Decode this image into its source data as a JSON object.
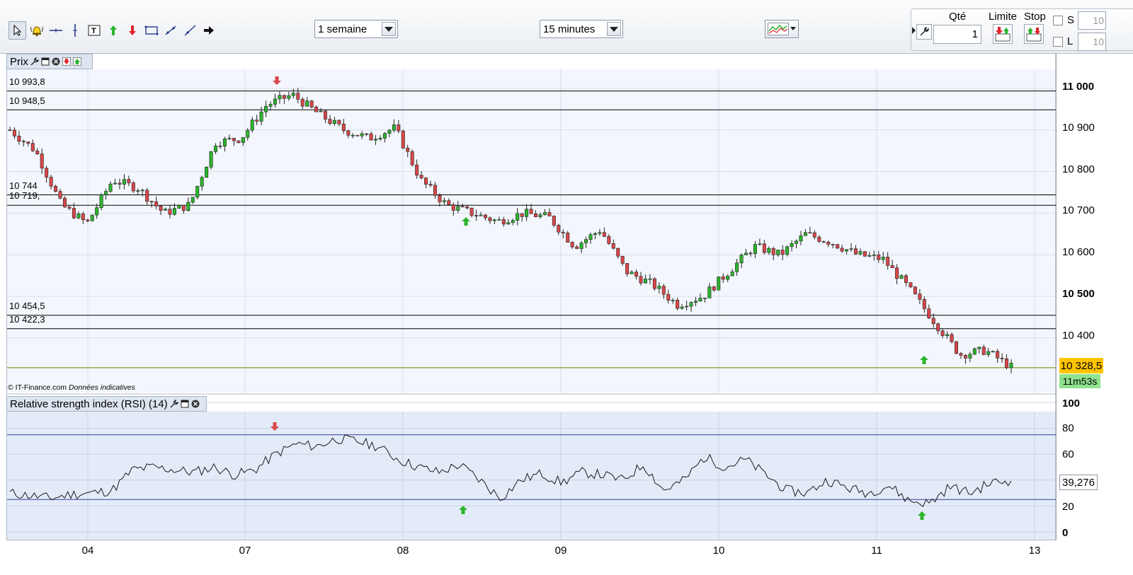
{
  "toolbar": {
    "tools": [
      "cursor-icon",
      "alert-bell-icon",
      "horizontal-line-icon",
      "vertical-line-icon",
      "text-tool-icon",
      "buy-arrow-icon",
      "sell-arrow-icon",
      "rectangle-icon",
      "trendline-icon",
      "ray-icon",
      "arrow-right-icon"
    ],
    "period": "1 semaine",
    "interval": "15 minutes"
  },
  "order_panel": {
    "qty_label": "Qté",
    "qty_value": "1",
    "limit_label": "Limite",
    "stop_label": "Stop",
    "s_label": "S",
    "l_label": "L",
    "s_value": "10",
    "l_value": "10"
  },
  "price_panel": {
    "title": "Prix",
    "levels": [
      "10 993,8",
      "10 948,5",
      "10 744",
      "10 719,",
      "10 454,5",
      "10 422,3"
    ],
    "y_ticks": [
      "11 000",
      "10 900",
      "10 800",
      "10 700",
      "10 600",
      "10 500",
      "10 400"
    ],
    "last_price": "10 328,5",
    "timer": "11m53s",
    "copyright": "© IT-Finance.com",
    "disclaimer": "Données indicatives"
  },
  "rsi_panel": {
    "title": "Relative strength index (RSI) (14)",
    "y_ticks": [
      "100",
      "80",
      "60",
      "40",
      "20",
      "0"
    ],
    "last_value": "39,276"
  },
  "x_axis": {
    "labels": [
      "04",
      "07",
      "08",
      "09",
      "10",
      "11",
      "13"
    ]
  },
  "colors": {
    "up": "#2bb52b",
    "down": "#d9474a",
    "level": "#000000",
    "last_price_line": "#8a9a2a",
    "rsi_line": "#1a1a1a",
    "rsi_band": "#2d3f9b"
  },
  "chart_data": [
    {
      "type": "candlestick",
      "title": "Prix",
      "x": [
        "04",
        "07",
        "08",
        "09",
        "10",
        "11",
        "13"
      ],
      "series": [
        {
          "name": "Prix",
          "values": [
            10900,
            10850,
            10720,
            10675,
            10780,
            10760,
            10700,
            10720,
            10870,
            10880,
            10960,
            10985,
            10940,
            10900,
            10880,
            10905,
            10780,
            10720,
            10700,
            10680,
            10700,
            10690,
            10620,
            10660,
            10560,
            10530,
            10480,
            10500,
            10560,
            10620,
            10600,
            10650,
            10630,
            10600,
            10590,
            10520,
            10440,
            10360,
            10370,
            10330
          ]
        }
      ],
      "horizontal_levels": [
        10993.8,
        10948.5,
        10744,
        10719,
        10454.5,
        10422.3
      ],
      "last": 10328.5,
      "ylim": [
        10300,
        11020
      ]
    },
    {
      "type": "line",
      "title": "Relative strength index (RSI) (14)",
      "series": [
        {
          "name": "RSI",
          "values": [
            30,
            28,
            26,
            29,
            30,
            32,
            48,
            50,
            48,
            46,
            50,
            44,
            48,
            60,
            68,
            66,
            72,
            70,
            66,
            56,
            50,
            46,
            52,
            40,
            26,
            40,
            45,
            38,
            46,
            44,
            40,
            52,
            32,
            40,
            58,
            50,
            56,
            44,
            32,
            30,
            40,
            34,
            30,
            36,
            24,
            22,
            35,
            30,
            38,
            39.3
          ]
        }
      ],
      "bands": [
        75,
        25
      ],
      "ylim": [
        0,
        100
      ]
    }
  ]
}
